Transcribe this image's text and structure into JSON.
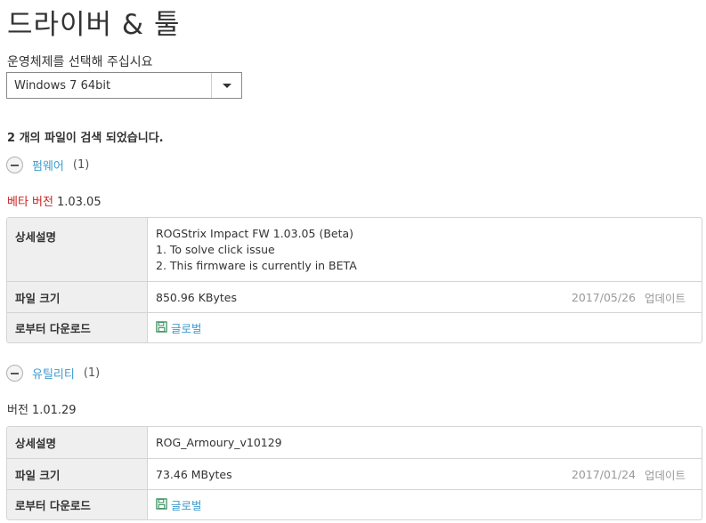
{
  "page": {
    "title": "드라이버 & 툴"
  },
  "os_selector": {
    "label": "운영체제를 선택해 주십시요",
    "selected": "Windows 7 64bit"
  },
  "results": {
    "summary": "2 개의 파일이 검색 되었습니다."
  },
  "sections": [
    {
      "name": "펌웨어",
      "count": "(1)",
      "version_tag": "베타 버전",
      "version": "1.03.05",
      "labels": {
        "description": "상세설명",
        "size": "파일 크기",
        "download": "로부터 다운로드"
      },
      "description_lines": [
        "ROGStrix Impact FW 1.03.05 (Beta)",
        "1. To solve click issue",
        "2. This firmware is currently in BETA"
      ],
      "size": "850.96 KBytes",
      "date": "2017/05/26",
      "update_label": "업데이트",
      "download_link": "글로벌",
      "accent_color": "#cc2222"
    },
    {
      "name": "유틸리티",
      "count": "(1)",
      "version_tag": "버전",
      "version": "1.01.29",
      "labels": {
        "description": "상세설명",
        "size": "파일 크기",
        "download": "로부터 다운로드"
      },
      "description_lines": [
        "ROG_Armoury_v10129"
      ],
      "size": "73.46 MBytes",
      "date": "2017/01/24",
      "update_label": "업데이트",
      "download_link": "글로벌"
    }
  ],
  "colors": {
    "link": "#3c9bd0",
    "beta": "#cc2222",
    "label_bg": "#efefef"
  },
  "icons": {
    "toggle": "collapse-minus-icon",
    "download": "floppy-save-icon",
    "dropdown": "chevron-down-icon"
  }
}
